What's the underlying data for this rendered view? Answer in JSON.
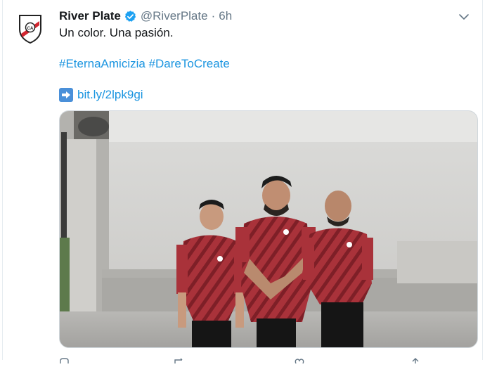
{
  "tweet": {
    "display_name": "River Plate",
    "handle": "@RiverPlate",
    "separator": "·",
    "time": "6h",
    "line1": "Un color. Una pasión.",
    "hashtags": [
      "#EternaAmicizia",
      "#DareToCreate"
    ],
    "link": "bit.ly/2lpk9gi"
  },
  "icons": {
    "avatar": "river-plate-crest",
    "verified": "verified-badge-icon",
    "more": "chevron-down-icon",
    "arrow": "right-arrow-emoji"
  },
  "colors": {
    "link": "#1b95e0",
    "meta": "#657786",
    "verified": "#1da1f2",
    "jersey": "#a9323a"
  }
}
